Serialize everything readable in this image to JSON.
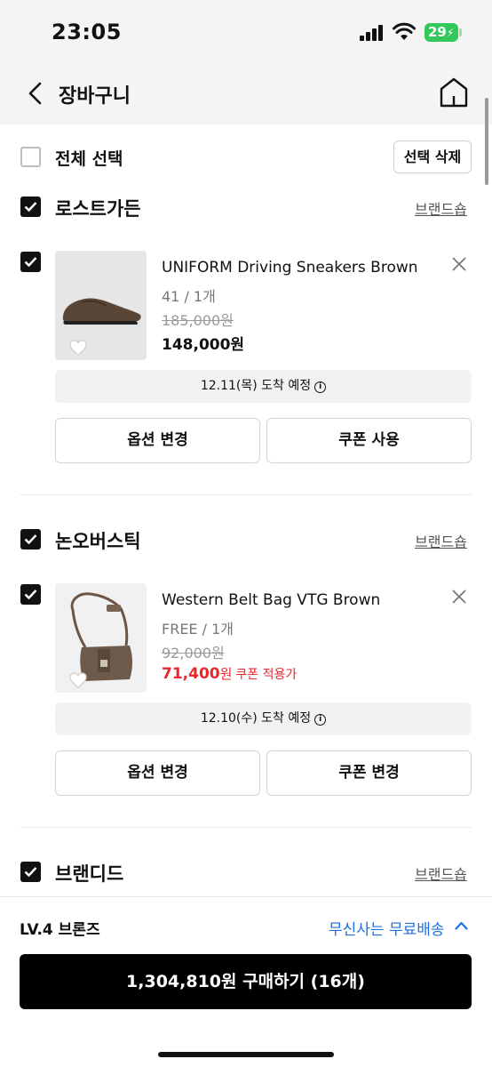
{
  "status_bar": {
    "time": "23:05",
    "battery": "29"
  },
  "header": {
    "title": "장바구니"
  },
  "select_all": {
    "label": "전체 선택",
    "delete_button": "선택 삭제"
  },
  "brands": [
    {
      "name": "로스트가든",
      "link": "브랜드숍",
      "item": {
        "name": "UNIFORM Driving Sneakers Brown",
        "option": "41 / 1개",
        "original_price": "185,000원",
        "price": "148,000원",
        "coupon_note": "",
        "delivery": "12.11(목) 도착 예정",
        "buttons": [
          "옵션 변경",
          "쿠폰 사용"
        ]
      }
    },
    {
      "name": "논오버스틱",
      "link": "브랜드숍",
      "item": {
        "name": "Western Belt Bag VTG Brown",
        "option": "FREE / 1개",
        "original_price": "92,000원",
        "price": "71,400",
        "price_unit": "원",
        "coupon_note": "쿠폰 적용가",
        "delivery": "12.10(수) 도착 예정",
        "buttons": [
          "옵션 변경",
          "쿠폰 변경"
        ]
      }
    },
    {
      "name": "브랜디드",
      "link": "브랜드숍"
    }
  ],
  "bottom": {
    "level": "LV.4 브론즈",
    "free_shipping": "무신사는 무료배송",
    "purchase_button": "1,304,810원 구매하기 (16개)"
  },
  "colors": {
    "accent_blue": "#1e6fe0",
    "sale_red": "#e8262c",
    "battery_green": "#34c759"
  }
}
